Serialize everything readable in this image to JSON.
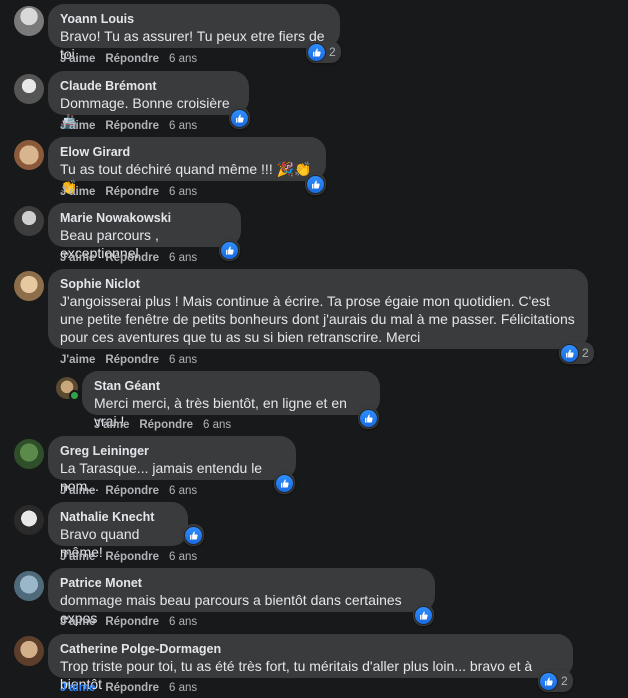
{
  "comments": [
    {
      "author": "Yoann Louis",
      "text": "Bravo! Tu as assurer! Tu peux etre fiers de toi.",
      "like": "J'aime",
      "reply": "Répondre",
      "time": "6 ans",
      "reactions": "2"
    },
    {
      "author": "Claude Brémont",
      "text": "Dommage. Bonne croisière 🚢",
      "like": "J'aime",
      "reply": "Répondre",
      "time": "6 ans"
    },
    {
      "author": "Elow Girard",
      "text": "Tu as tout déchiré quand même !!! 🎉👏👏",
      "like": "J'aime",
      "reply": "Répondre",
      "time": "6 ans"
    },
    {
      "author": "Marie Nowakowski",
      "text": "Beau parcours , exceptionnel",
      "like": "J'aime",
      "reply": "Répondre",
      "time": "6 ans"
    },
    {
      "author": "Sophie Niclot",
      "text": "J'angoisserai plus ! Mais continue à écrire. Ta prose égaie mon quotidien. C'est une petite fenêtre de petits bonheurs dont j'aurais du mal à me passer. Félicitations pour ces aventures que tu as su si bien retranscrire. Merci",
      "like": "J'aime",
      "reply": "Répondre",
      "time": "6 ans",
      "reactions": "2"
    },
    {
      "author": "Stan Géant",
      "text": "Merci merci, à très bientôt, en ligne et en vrai !",
      "like": "J'aime",
      "reply": "Répondre",
      "time": "6 ans"
    },
    {
      "author": "Greg Leininger",
      "text": "La Tarasque... jamais entendu le nom...",
      "like": "J'aime",
      "reply": "Répondre",
      "time": "6 ans"
    },
    {
      "author": "Nathalie Knecht",
      "text": "Bravo quand même!",
      "like": "J'aime",
      "reply": "Répondre",
      "time": "6 ans"
    },
    {
      "author": "Patrice Monet",
      "text": "dommage mais beau parcours a bientôt dans certaines expos",
      "like": "J'aime",
      "reply": "Répondre",
      "time": "6 ans"
    },
    {
      "author": "Catherine Polge-Dormagen",
      "text": "Trop triste pour toi, tu as été très fort, tu méritais d'aller plus loin... bravo et à bientôt",
      "like": "J'aime",
      "reply": "Répondre",
      "time": "6 ans",
      "reactions": "2"
    }
  ],
  "colors": {
    "like_blue": "#2d88ff",
    "bubble": "#3a3b3c",
    "background": "#18191a",
    "online": "#31a24c"
  },
  "icons": {
    "reaction": "thumbs-up-icon",
    "avatar": "profile-photo"
  }
}
